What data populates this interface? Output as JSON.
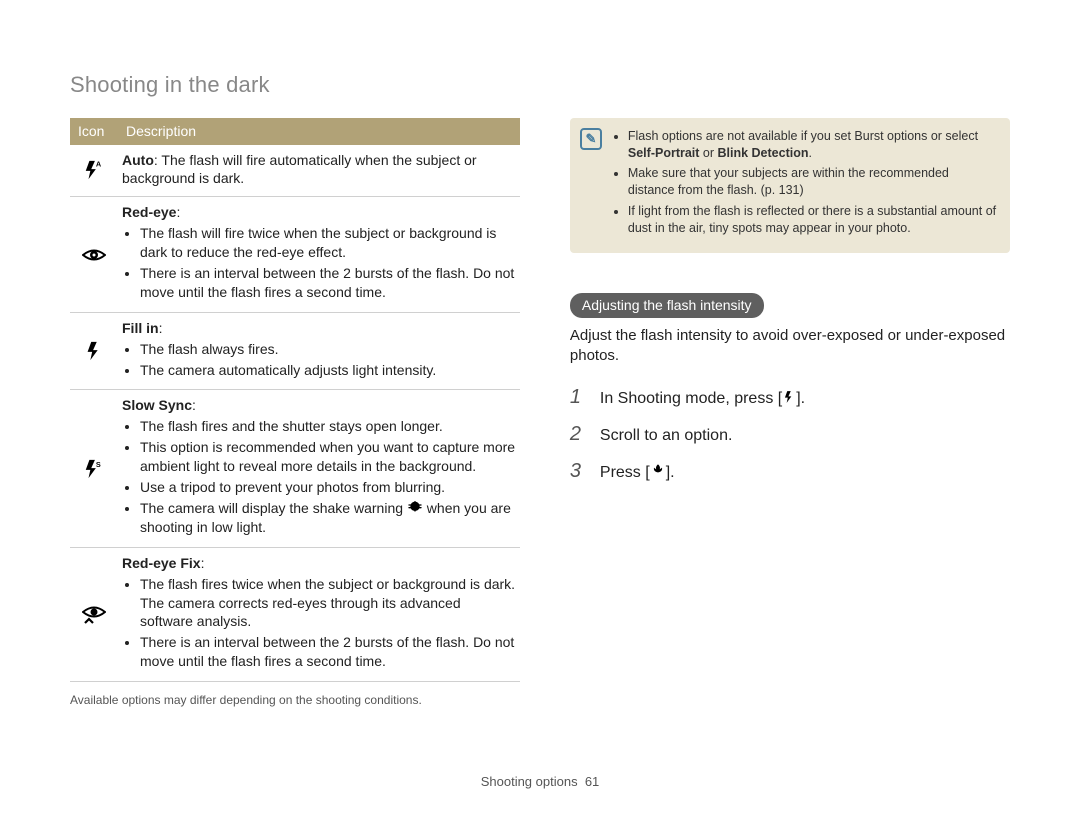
{
  "page_title": "Shooting in the dark",
  "table": {
    "header_icon": "Icon",
    "header_desc": "Description",
    "rows": [
      {
        "icon": "flash-auto",
        "title": "Auto",
        "inline_text": ": The flash will fire automatically when the subject or background is dark."
      },
      {
        "icon": "red-eye",
        "title": "Red-eye",
        "bullets": [
          "The flash will fire twice when the subject or background is dark to reduce the red-eye effect.",
          "There is an interval between the 2 bursts of the flash. Do not move until the flash fires a second time."
        ]
      },
      {
        "icon": "fill-in",
        "title": "Fill in",
        "bullets": [
          "The flash always fires.",
          "The camera automatically adjusts light intensity."
        ]
      },
      {
        "icon": "slow-sync",
        "title": "Slow Sync",
        "bullets": [
          "The flash fires and the shutter stays open longer.",
          "This option is recommended when you want to capture more ambient light to reveal more details in the background.",
          "Use a tripod to prevent your photos from blurring.",
          "The camera will display the shake warning {shake} when you are shooting in low light."
        ]
      },
      {
        "icon": "red-eye-fix",
        "title": "Red-eye Fix",
        "bullets": [
          "The flash fires twice when the subject or background is dark. The camera corrects red-eyes through its advanced software analysis.",
          "There is an interval between the 2 bursts of the flash. Do not move until the flash fires a second time."
        ]
      }
    ],
    "footnote": "Available options may differ depending on the shooting conditions."
  },
  "notes": {
    "items": [
      {
        "pre": "Flash options are not available if you set Burst options or select ",
        "bold1": "Self-Portrait",
        "mid": " or ",
        "bold2": "Blink Detection",
        "post": "."
      },
      {
        "text": "Make sure that your subjects are within the recommended distance from the flash. (p. 131)"
      },
      {
        "text": "If light from the flash is reflected or there is a substantial amount of dust in the air, tiny spots may appear in your photo."
      }
    ]
  },
  "section": {
    "pill": "Adjusting the flash intensity",
    "desc": "Adjust the flash intensity to avoid over-exposed or under-exposed photos.",
    "steps": [
      {
        "n": "1",
        "pre": "In Shooting mode, press [",
        "icon": "flash",
        "post": "]."
      },
      {
        "n": "2",
        "text": "Scroll to an option."
      },
      {
        "n": "3",
        "pre": "Press [",
        "icon": "macro",
        "post": "]."
      }
    ]
  },
  "footer": {
    "label": "Shooting options",
    "page": "61"
  }
}
